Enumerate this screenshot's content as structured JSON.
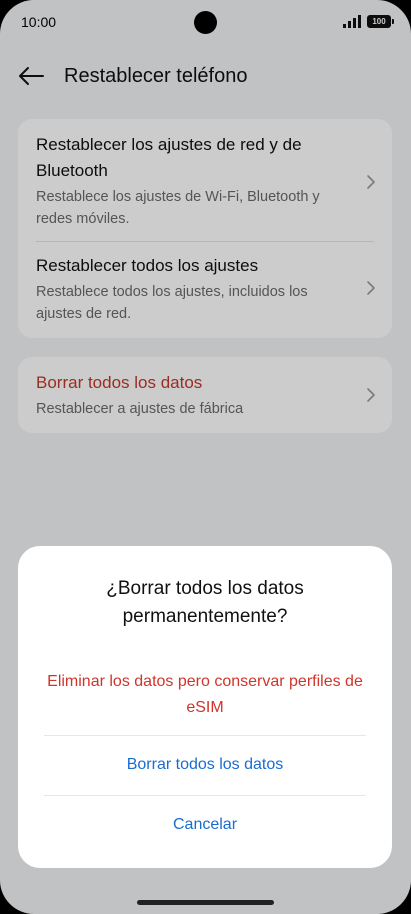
{
  "status_bar": {
    "time": "10:00",
    "battery": "100"
  },
  "header": {
    "title": "Restablecer teléfono"
  },
  "settings": {
    "items": [
      {
        "title": "Restablecer los ajustes de red y de Bluetooth",
        "subtitle": "Restablece los ajustes de Wi-Fi, Bluetooth y redes móviles."
      },
      {
        "title": "Restablecer todos los ajustes",
        "subtitle": "Restablece todos los ajustes, incluidos los ajustes de red."
      },
      {
        "title": "Borrar todos los datos",
        "subtitle": "Restablecer a ajustes de fábrica"
      }
    ]
  },
  "dialog": {
    "title": "¿Borrar todos los datos permanentemente?",
    "option_keep_esim": "Eliminar los datos pero conservar perfiles de eSIM",
    "option_erase_all": "Borrar todos los datos",
    "option_cancel": "Cancelar"
  },
  "colors": {
    "danger": "#c0392b",
    "accent": "#1a6dd0"
  }
}
